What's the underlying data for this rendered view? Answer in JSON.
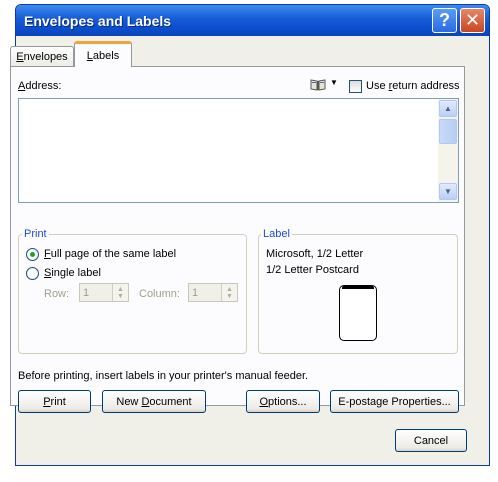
{
  "window": {
    "title": "Envelopes and Labels",
    "help_glyph": "?",
    "close_glyph": "✕"
  },
  "tabs": [
    {
      "label_pre": "",
      "label_key": "E",
      "label_post": "nvelopes"
    },
    {
      "label_pre": "",
      "label_key": "L",
      "label_post": "abels"
    }
  ],
  "address": {
    "label_pre": "",
    "label_key": "A",
    "label_post": "ddress:",
    "value": "",
    "book_icon": "address-book-icon",
    "dropdown_glyph": "▼",
    "use_return_pre": "Use ",
    "use_return_key": "r",
    "use_return_post": "eturn address",
    "use_return_checked": false
  },
  "scrollbar": {
    "up_glyph": "▲",
    "down_glyph": "▼"
  },
  "print_group": {
    "title": "Print",
    "full_page_key": "F",
    "full_page_post": "ull page of the same label",
    "full_page_selected": true,
    "single_key": "S",
    "single_post": "ingle label",
    "row_label": "Row:",
    "row_value": "1",
    "column_label": "Column:",
    "column_value": "1",
    "spin_up": "▲",
    "spin_down": "▼"
  },
  "label_group": {
    "title": "Label",
    "line1": "Microsoft,  1/2 Letter",
    "line2": "1/2 Letter Postcard"
  },
  "instruction": "Before printing, insert labels in your printer's manual feeder.",
  "buttons": {
    "print_key": "P",
    "print_post": "rint",
    "new_doc_pre": "New ",
    "new_doc_key": "D",
    "new_doc_post": "ocument",
    "options_key": "O",
    "options_post": "ptions...",
    "epostage": "E-postage Properties...",
    "cancel": "Cancel"
  },
  "colors": {
    "titlebar": "#0b4fd0",
    "group_title": "#1f4bd6",
    "tab_highlight": "#f2a33a",
    "radio_dot": "#21a121"
  }
}
